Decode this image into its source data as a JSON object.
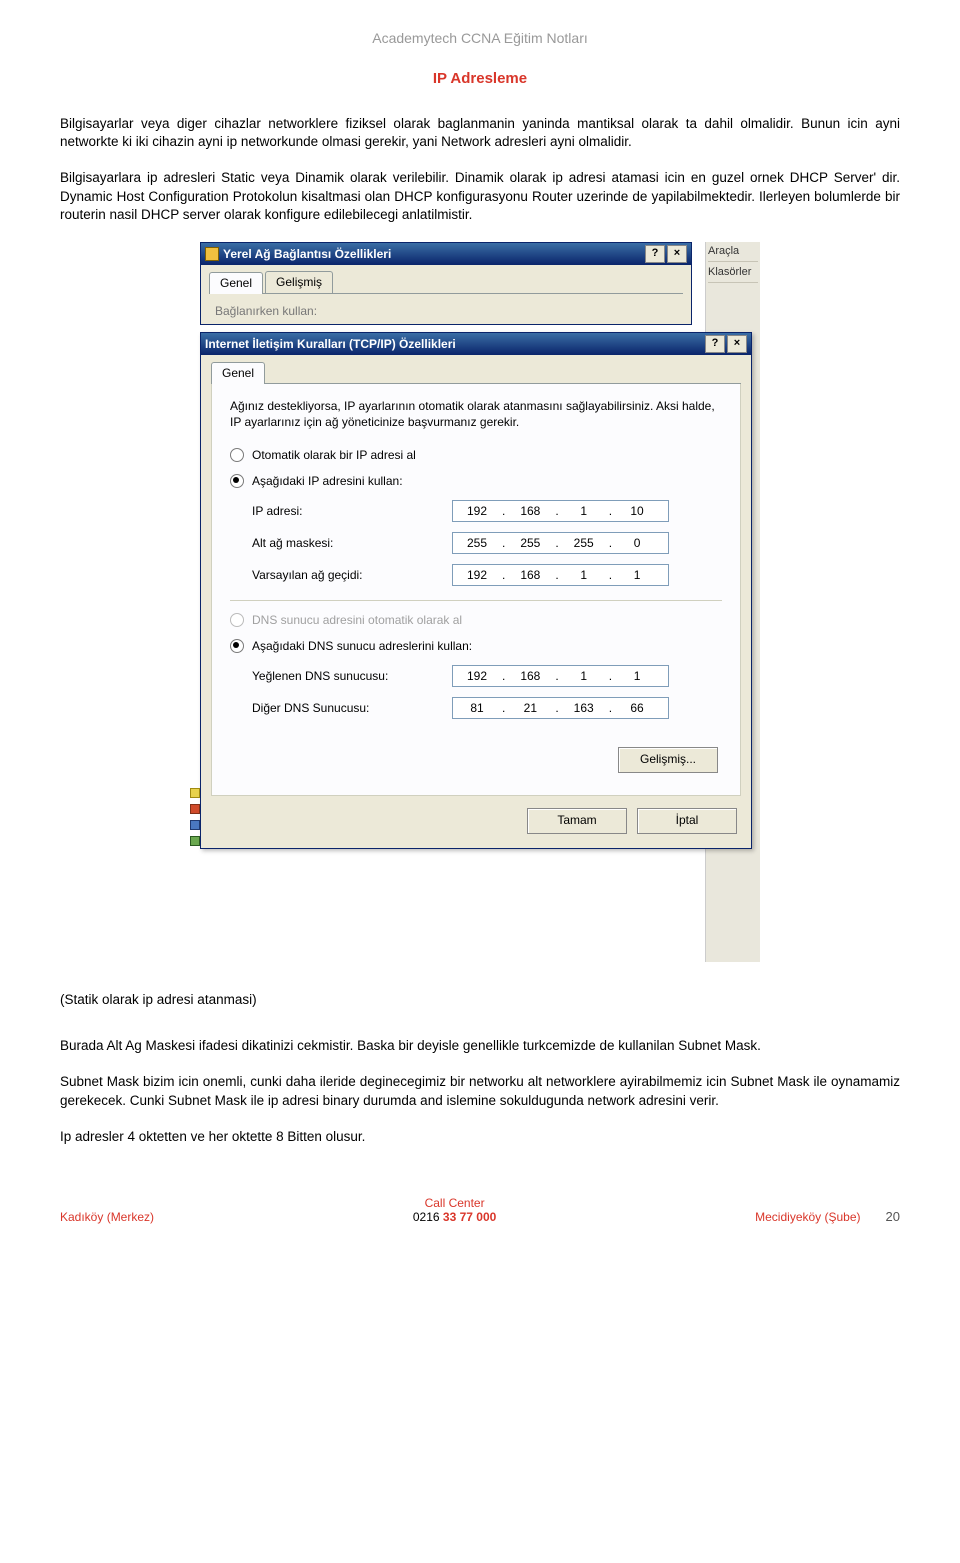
{
  "header": {
    "doc_title": "Academytech CCNA Eğitim Notları"
  },
  "section": {
    "title": "IP Adresleme"
  },
  "paragraphs": {
    "p1": "Bilgisayarlar veya diger cihazlar networklere fiziksel olarak baglanmanin yaninda mantiksal olarak ta dahil olmalidir. Bunun icin ayni networkte ki iki cihazin ayni ip networkunde olmasi gerekir, yani Network adresleri ayni olmalidir.",
    "p2": "Bilgisayarlara ip adresleri Static veya Dinamik olarak verilebilir. Dinamik olarak ip adresi atamasi icin en guzel ornek DHCP Server' dir. Dynamic Host Configuration Protokolun kisaltmasi olan DHCP konfigurasyonu Router uzerinde de yapilabilmektedir. Ilerleyen bolumlerde bir routerin nasil DHCP server olarak konfigure edilebilecegi anlatilmistir.",
    "caption": "(Statik olarak ip adresi atanmasi)",
    "p3": "Burada Alt Ag Maskesi ifadesi dikatinizi cekmistir. Baska bir deyisle genellikle turkcemizde de kullanilan Subnet Mask.",
    "p4": "Subnet Mask bizim icin onemli, cunki daha ileride deginecegimiz bir networku alt networklere ayirabilmemiz icin Subnet Mask ile oynamamiz gerekecek. Cunki Subnet Mask ile ip adresi binary durumda and islemine sokuldugunda network adresini verir.",
    "p5": "Ip adresler 4 oktetten ve her oktette 8 Bitten olusur."
  },
  "desktop": {
    "item1": "Araçla",
    "item2": "Klasörler"
  },
  "win1": {
    "title": "Yerel Ağ Bağlantısı Özellikleri",
    "tab_general": "Genel",
    "tab_advanced": "Gelişmiş",
    "conn_prompt": "Bağlanırken kullan:",
    "help_btn": "?",
    "close_btn": "×"
  },
  "win2": {
    "title": "Internet İletişim Kuralları (TCP/IP) Özellikleri",
    "tab_general": "Genel",
    "desc": "Ağınız destekliyorsa, IP ayarlarının otomatik olarak atanmasını sağlayabilirsiniz. Aksi halde, IP ayarlarınız için ağ yöneticinize başvurmanız gerekir.",
    "radio_auto_ip": "Otomatik olarak bir IP adresi al",
    "radio_manual_ip": "Aşağıdaki IP adresini kullan:",
    "lbl_ip": "IP adresi:",
    "lbl_mask": "Alt ağ maskesi:",
    "lbl_gw": "Varsayılan ağ geçidi:",
    "radio_auto_dns": "DNS sunucu adresini otomatik olarak al",
    "radio_manual_dns": "Aşağıdaki DNS sunucu adreslerini kullan:",
    "lbl_pref_dns": "Yeğlenen DNS sunucusu:",
    "lbl_alt_dns": "Diğer DNS Sunucusu:",
    "btn_adv": "Gelişmiş...",
    "btn_ok": "Tamam",
    "btn_cancel": "İptal",
    "ip": {
      "o1": "192",
      "o2": "168",
      "o3": "1",
      "o4": "10"
    },
    "mask": {
      "o1": "255",
      "o2": "255",
      "o3": "255",
      "o4": "0"
    },
    "gw": {
      "o1": "192",
      "o2": "168",
      "o3": "1",
      "o4": "1"
    },
    "dns1": {
      "o1": "192",
      "o2": "168",
      "o3": "1",
      "o4": "1"
    },
    "dns2": {
      "o1": "81",
      "o2": "21",
      "o3": "163",
      "o4": "66"
    }
  },
  "footer": {
    "left": "Kadıköy (Merkez)",
    "center_label": "Call Center",
    "phone_prefix": "0216 ",
    "phone_bold": "33 77 000",
    "right": "Mecidiyeköy (Şube)",
    "page": "20"
  }
}
